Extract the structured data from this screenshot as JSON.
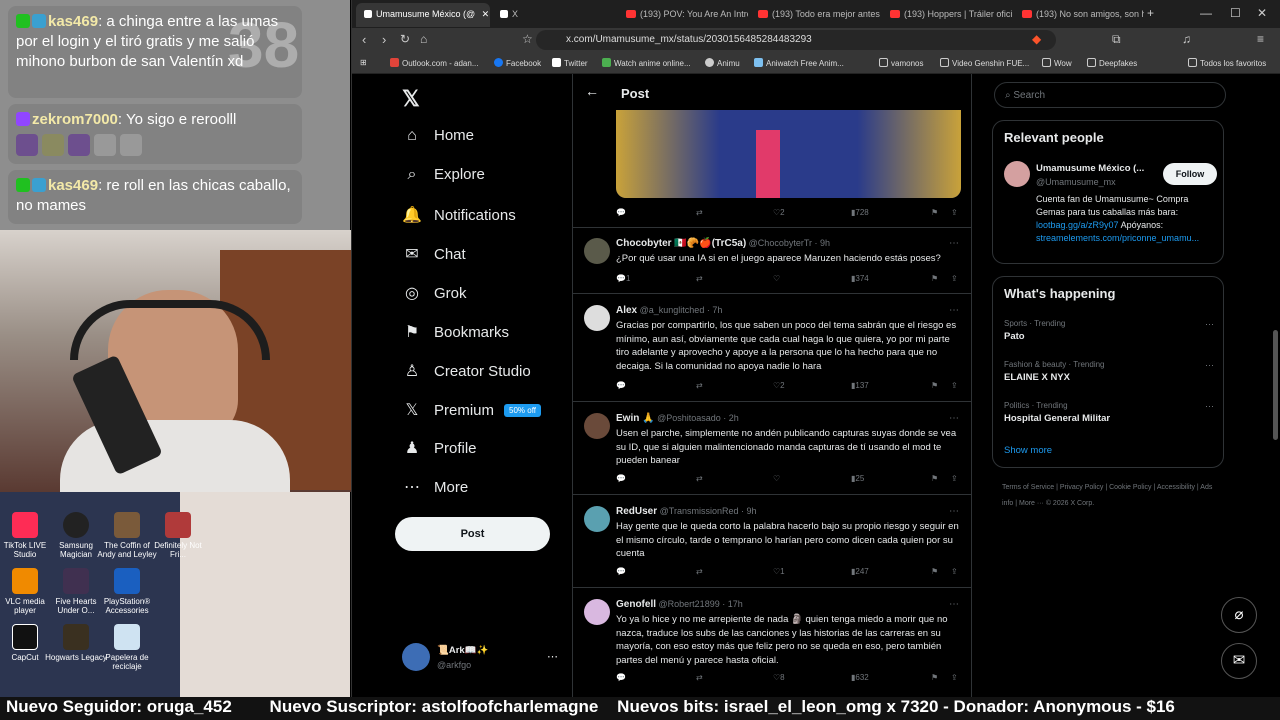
{
  "overlay": {
    "chat": [
      {
        "user": "kas469",
        "text": ": a chinga entre a las umas por el login y el tiró gratis y me salió mihono burbon de san Valentín xd"
      },
      {
        "user": "zekrom7000",
        "text": ": Yo sigo e reroolll"
      },
      {
        "user": "kas469",
        "text": ": re roll en las chicas caballo, no mames"
      }
    ],
    "bigdigits": "38",
    "desktop_icons": [
      "TikTok LIVE Studio",
      "Samsung Magician",
      "The Coffin of Andy and Leyley",
      "Definitely Not Fri...",
      "VLC media player",
      "Five Hearts Under O...",
      "PlayStation® Accessories",
      "CapCut",
      "Hogwarts Legacy",
      "Papelera de reciclaje"
    ],
    "bottom_bar": "Nuevo Seguidor: oruga_452        Nuevo Suscriptor: astolfoofcharlemagne    Nuevos bits: israel_el_leon_omg x 7320 - Donador: Anonymous - $16"
  },
  "browser": {
    "tabs": [
      {
        "label": "Umamusume México (@",
        "color": "#fff"
      },
      {
        "label": "X",
        "color": "#fff"
      },
      {
        "label": "(193) POV: You Are An Intro",
        "color": "#ff3333"
      },
      {
        "label": "(193) Todo era mejor antes",
        "color": "#ff3333"
      },
      {
        "label": "(193) Hoppers | Tráiler ofici",
        "color": "#ff3333"
      },
      {
        "label": "(193) No son amigos, son h",
        "color": "#ff3333"
      }
    ],
    "url": "x.com/Umamusume_mx/status/2030156485284483293",
    "bookmarks": [
      "Outlook.com - adan...",
      "Facebook",
      "Twitter",
      "Watch anime online...",
      "Animu",
      "Aniwatch Free Anim...",
      "vamonos",
      "Video Genshin FUE...",
      "Wow",
      "Deepfakes",
      "Todos los favoritos"
    ]
  },
  "nav": {
    "items": [
      {
        "label": "Home",
        "icon": "⌂"
      },
      {
        "label": "Explore",
        "icon": "⌕"
      },
      {
        "label": "Notifications",
        "icon": "🔔"
      },
      {
        "label": "Chat",
        "icon": "✉"
      },
      {
        "label": "Grok",
        "icon": "◎"
      },
      {
        "label": "Bookmarks",
        "icon": "⚑"
      },
      {
        "label": "Creator Studio",
        "icon": "♙"
      },
      {
        "label": "Premium",
        "icon": "𝕏"
      },
      {
        "label": "Profile",
        "icon": "♟"
      },
      {
        "label": "More",
        "icon": "⋯"
      }
    ],
    "premium_badge": "50% off",
    "post_button": "Post",
    "account_name": "📜Ark📖✨",
    "account_handle": "@arkfgo"
  },
  "header": {
    "title": "Post"
  },
  "main_post_stats": {
    "likes": "2",
    "views": "728"
  },
  "replies": [
    {
      "name": "Chocobyter 🇲🇽🥐🍎(TrC5a)",
      "handle": "@ChocobyterTr · 9h",
      "text": "¿Por qué usar una IA si en el juego aparece Maruzen haciendo estás poses?",
      "replies": "1",
      "retweets": "",
      "likes": "",
      "views": "374"
    },
    {
      "name": "Alex",
      "handle": "@a_kunglitched · 7h",
      "text": "Gracias por compartirlo, los que saben un poco del tema sabrán que el riesgo es mínimo, aun así, obviamente que cada cual haga lo que quiera, yo por mi parte tiro adelante y aprovecho y apoye a la persona que lo ha hecho para que no decaiga. Si la comunidad no apoya nadie lo hara",
      "replies": "",
      "retweets": "",
      "likes": "2",
      "views": "137"
    },
    {
      "name": "Ewin 🙏",
      "handle": "@Poshitoasado · 2h",
      "text": "Usen el parche, simplemente no andén publicando capturas suyas donde se vea su ID, que si alguien malintencionado manda capturas de tí usando el mod te pueden banear",
      "replies": "",
      "retweets": "",
      "likes": "",
      "views": "25"
    },
    {
      "name": "RedUser",
      "handle": "@TransmissionRed · 9h",
      "text": "Hay gente que le queda corto la palabra hacerlo bajo su propio riesgo y seguir en el mismo círculo, tarde o temprano lo harían pero como dicen cada quien por su cuenta",
      "replies": "",
      "retweets": "",
      "likes": "1",
      "views": "247"
    },
    {
      "name": "Genofell",
      "handle": "@Robert21899 · 17h",
      "text": "Yo ya lo hice y no me arrepiente de nada 🗿 quien tenga miedo a morir que no nazca, traduce los subs de las canciones y las historias de las carreras en su mayoría, con eso estoy más que feliz pero no se queda en eso, pero también partes del menú y parece hasta oficial.",
      "replies": "",
      "retweets": "",
      "likes": "8",
      "views": "632"
    }
  ],
  "sidebar": {
    "search_placeholder": "Search",
    "relevant_title": "Relevant people",
    "person_name": "Umamusume México (...",
    "person_handle": "@Umamusume_mx",
    "follow": "Follow",
    "bio1": "Cuenta fan de Umamusume~ Compra Gemas para tus caballas más bara:",
    "bio_link1": "lootbag.gg/a/zR9y07",
    "bio2": " Apóyanos:",
    "bio_link2": "streamelements.com/priconne_umamu...",
    "happening_title": "What's happening",
    "trends": [
      {
        "cat": "Sports · Trending",
        "name": "Pato"
      },
      {
        "cat": "Fashion & beauty · Trending",
        "name": "ELAINE X NYX"
      },
      {
        "cat": "Politics · Trending",
        "name": "Hospital General Militar"
      }
    ],
    "show_more": "Show more",
    "footer": "Terms of Service  |  Privacy Policy  |  Cookie Policy  |  Accessibility  |  Ads info  |  More ···  © 2026 X Corp."
  },
  "colors": {
    "accent": "#1d9bf0",
    "bg": "#000000",
    "border": "#2f3336"
  }
}
